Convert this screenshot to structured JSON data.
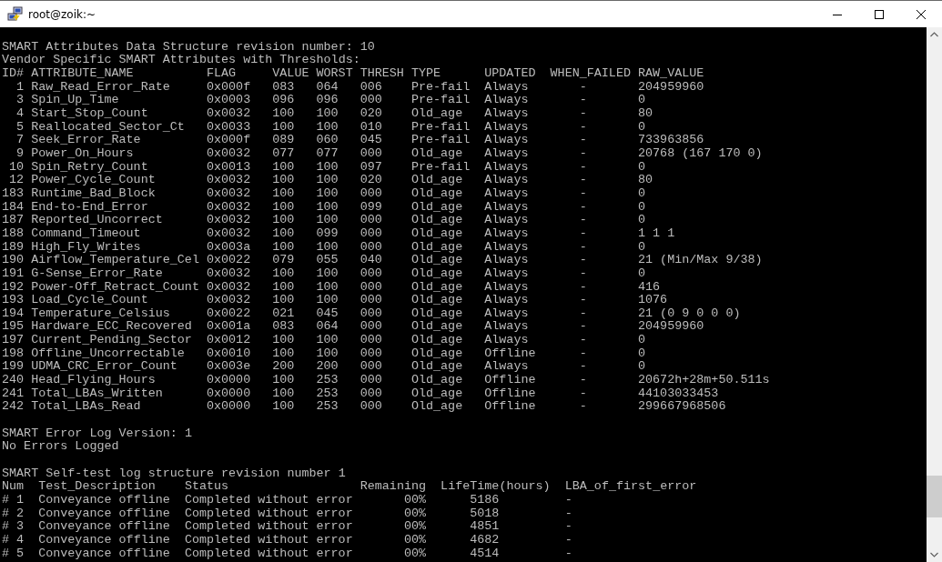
{
  "window": {
    "title": "root@zoik:~"
  },
  "terminal": {
    "revision_line": "SMART Attributes Data Structure revision number: 10",
    "vendor_line": "Vendor Specific SMART Attributes with Thresholds:",
    "attributes": {
      "columns": [
        "ID#",
        "ATTRIBUTE_NAME",
        "FLAG",
        "VALUE",
        "WORST",
        "THRESH",
        "TYPE",
        "UPDATED",
        "WHEN_FAILED",
        "RAW_VALUE"
      ],
      "rows": [
        {
          "id": "1",
          "name": "Raw_Read_Error_Rate",
          "flag": "0x000f",
          "value": "083",
          "worst": "064",
          "thresh": "006",
          "type": "Pre-fail",
          "updated": "Always",
          "when_failed": "-",
          "raw_value": "204959960"
        },
        {
          "id": "3",
          "name": "Spin_Up_Time",
          "flag": "0x0003",
          "value": "096",
          "worst": "096",
          "thresh": "000",
          "type": "Pre-fail",
          "updated": "Always",
          "when_failed": "-",
          "raw_value": "0"
        },
        {
          "id": "4",
          "name": "Start_Stop_Count",
          "flag": "0x0032",
          "value": "100",
          "worst": "100",
          "thresh": "020",
          "type": "Old_age",
          "updated": "Always",
          "when_failed": "-",
          "raw_value": "80"
        },
        {
          "id": "5",
          "name": "Reallocated_Sector_Ct",
          "flag": "0x0033",
          "value": "100",
          "worst": "100",
          "thresh": "010",
          "type": "Pre-fail",
          "updated": "Always",
          "when_failed": "-",
          "raw_value": "0"
        },
        {
          "id": "7",
          "name": "Seek_Error_Rate",
          "flag": "0x000f",
          "value": "089",
          "worst": "060",
          "thresh": "045",
          "type": "Pre-fail",
          "updated": "Always",
          "when_failed": "-",
          "raw_value": "733963856"
        },
        {
          "id": "9",
          "name": "Power_On_Hours",
          "flag": "0x0032",
          "value": "077",
          "worst": "077",
          "thresh": "000",
          "type": "Old_age",
          "updated": "Always",
          "when_failed": "-",
          "raw_value": "20768 (167 170 0)"
        },
        {
          "id": "10",
          "name": "Spin_Retry_Count",
          "flag": "0x0013",
          "value": "100",
          "worst": "100",
          "thresh": "097",
          "type": "Pre-fail",
          "updated": "Always",
          "when_failed": "-",
          "raw_value": "0"
        },
        {
          "id": "12",
          "name": "Power_Cycle_Count",
          "flag": "0x0032",
          "value": "100",
          "worst": "100",
          "thresh": "020",
          "type": "Old_age",
          "updated": "Always",
          "when_failed": "-",
          "raw_value": "80"
        },
        {
          "id": "183",
          "name": "Runtime_Bad_Block",
          "flag": "0x0032",
          "value": "100",
          "worst": "100",
          "thresh": "000",
          "type": "Old_age",
          "updated": "Always",
          "when_failed": "-",
          "raw_value": "0"
        },
        {
          "id": "184",
          "name": "End-to-End_Error",
          "flag": "0x0032",
          "value": "100",
          "worst": "100",
          "thresh": "099",
          "type": "Old_age",
          "updated": "Always",
          "when_failed": "-",
          "raw_value": "0"
        },
        {
          "id": "187",
          "name": "Reported_Uncorrect",
          "flag": "0x0032",
          "value": "100",
          "worst": "100",
          "thresh": "000",
          "type": "Old_age",
          "updated": "Always",
          "when_failed": "-",
          "raw_value": "0"
        },
        {
          "id": "188",
          "name": "Command_Timeout",
          "flag": "0x0032",
          "value": "100",
          "worst": "099",
          "thresh": "000",
          "type": "Old_age",
          "updated": "Always",
          "when_failed": "-",
          "raw_value": "1 1 1"
        },
        {
          "id": "189",
          "name": "High_Fly_Writes",
          "flag": "0x003a",
          "value": "100",
          "worst": "100",
          "thresh": "000",
          "type": "Old_age",
          "updated": "Always",
          "when_failed": "-",
          "raw_value": "0"
        },
        {
          "id": "190",
          "name": "Airflow_Temperature_Cel",
          "flag": "0x0022",
          "value": "079",
          "worst": "055",
          "thresh": "040",
          "type": "Old_age",
          "updated": "Always",
          "when_failed": "-",
          "raw_value": "21 (Min/Max 9/38)"
        },
        {
          "id": "191",
          "name": "G-Sense_Error_Rate",
          "flag": "0x0032",
          "value": "100",
          "worst": "100",
          "thresh": "000",
          "type": "Old_age",
          "updated": "Always",
          "when_failed": "-",
          "raw_value": "0"
        },
        {
          "id": "192",
          "name": "Power-Off_Retract_Count",
          "flag": "0x0032",
          "value": "100",
          "worst": "100",
          "thresh": "000",
          "type": "Old_age",
          "updated": "Always",
          "when_failed": "-",
          "raw_value": "416"
        },
        {
          "id": "193",
          "name": "Load_Cycle_Count",
          "flag": "0x0032",
          "value": "100",
          "worst": "100",
          "thresh": "000",
          "type": "Old_age",
          "updated": "Always",
          "when_failed": "-",
          "raw_value": "1076"
        },
        {
          "id": "194",
          "name": "Temperature_Celsius",
          "flag": "0x0022",
          "value": "021",
          "worst": "045",
          "thresh": "000",
          "type": "Old_age",
          "updated": "Always",
          "when_failed": "-",
          "raw_value": "21 (0 9 0 0 0)"
        },
        {
          "id": "195",
          "name": "Hardware_ECC_Recovered",
          "flag": "0x001a",
          "value": "083",
          "worst": "064",
          "thresh": "000",
          "type": "Old_age",
          "updated": "Always",
          "when_failed": "-",
          "raw_value": "204959960"
        },
        {
          "id": "197",
          "name": "Current_Pending_Sector",
          "flag": "0x0012",
          "value": "100",
          "worst": "100",
          "thresh": "000",
          "type": "Old_age",
          "updated": "Always",
          "when_failed": "-",
          "raw_value": "0"
        },
        {
          "id": "198",
          "name": "Offline_Uncorrectable",
          "flag": "0x0010",
          "value": "100",
          "worst": "100",
          "thresh": "000",
          "type": "Old_age",
          "updated": "Offline",
          "when_failed": "-",
          "raw_value": "0"
        },
        {
          "id": "199",
          "name": "UDMA_CRC_Error_Count",
          "flag": "0x003e",
          "value": "200",
          "worst": "200",
          "thresh": "000",
          "type": "Old_age",
          "updated": "Always",
          "when_failed": "-",
          "raw_value": "0"
        },
        {
          "id": "240",
          "name": "Head_Flying_Hours",
          "flag": "0x0000",
          "value": "100",
          "worst": "253",
          "thresh": "000",
          "type": "Old_age",
          "updated": "Offline",
          "when_failed": "-",
          "raw_value": "20672h+28m+50.511s"
        },
        {
          "id": "241",
          "name": "Total_LBAs_Written",
          "flag": "0x0000",
          "value": "100",
          "worst": "253",
          "thresh": "000",
          "type": "Old_age",
          "updated": "Offline",
          "when_failed": "-",
          "raw_value": "44103033453"
        },
        {
          "id": "242",
          "name": "Total_LBAs_Read",
          "flag": "0x0000",
          "value": "100",
          "worst": "253",
          "thresh": "000",
          "type": "Old_age",
          "updated": "Offline",
          "when_failed": "-",
          "raw_value": "299667968506"
        }
      ]
    },
    "error_log": {
      "version_line": "SMART Error Log Version: 1",
      "status_line": "No Errors Logged"
    },
    "self_test": {
      "title": "SMART Self-test log structure revision number 1",
      "columns": [
        "Num",
        "Test_Description",
        "Status",
        "Remaining",
        "LifeTime(hours)",
        "LBA_of_first_error"
      ],
      "rows": [
        {
          "num": "# 1",
          "description": "Conveyance offline",
          "status": "Completed without error",
          "remaining": "00%",
          "lifetime": "5186",
          "lba": "-"
        },
        {
          "num": "# 2",
          "description": "Conveyance offline",
          "status": "Completed without error",
          "remaining": "00%",
          "lifetime": "5018",
          "lba": "-"
        },
        {
          "num": "# 3",
          "description": "Conveyance offline",
          "status": "Completed without error",
          "remaining": "00%",
          "lifetime": "4851",
          "lba": "-"
        },
        {
          "num": "# 4",
          "description": "Conveyance offline",
          "status": "Completed without error",
          "remaining": "00%",
          "lifetime": "4682",
          "lba": "-"
        },
        {
          "num": "# 5",
          "description": "Conveyance offline",
          "status": "Completed without error",
          "remaining": "00%",
          "lifetime": "4514",
          "lba": "-"
        }
      ]
    }
  }
}
